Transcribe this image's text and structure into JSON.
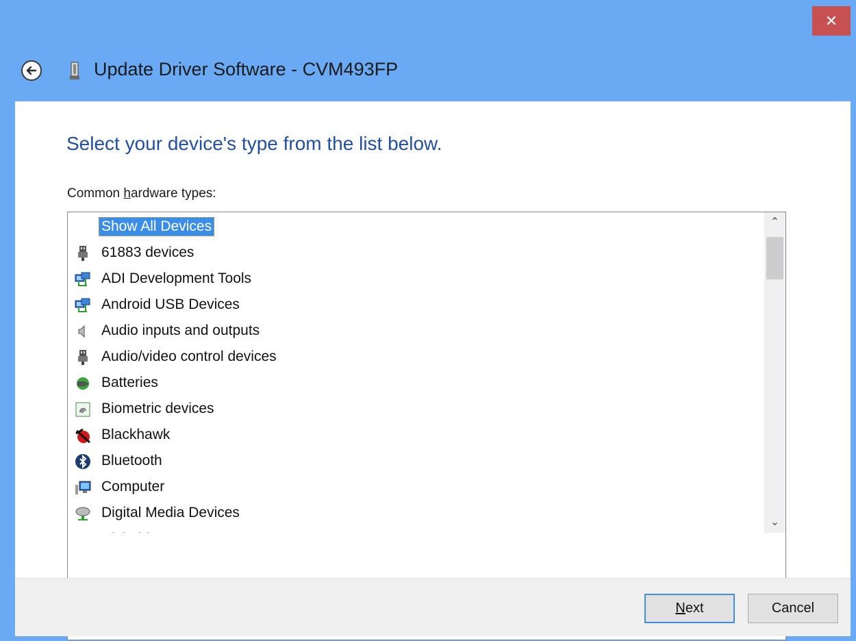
{
  "window": {
    "title": "Update Driver Software - CVM493FP",
    "close_glyph": "✕"
  },
  "main": {
    "heading": "Select your device's type from the list below.",
    "list_label_pre": "Common ",
    "list_label_u": "h",
    "list_label_post": "ardware types:"
  },
  "list": {
    "items": [
      {
        "label": "Show All Devices",
        "icon": "none",
        "selected": true
      },
      {
        "label": "61883 devices",
        "icon": "usb-plug-icon"
      },
      {
        "label": "ADI Development Tools",
        "icon": "network-computers-icon"
      },
      {
        "label": "Android USB Devices",
        "icon": "network-computers-icon"
      },
      {
        "label": "Audio inputs and outputs",
        "icon": "speaker-icon"
      },
      {
        "label": "Audio/video control devices",
        "icon": "usb-plug-icon"
      },
      {
        "label": "Batteries",
        "icon": "battery-plug-icon"
      },
      {
        "label": "Biometric devices",
        "icon": "fingerprint-icon"
      },
      {
        "label": "Blackhawk",
        "icon": "blackhawk-bug-icon"
      },
      {
        "label": "Bluetooth",
        "icon": "bluetooth-icon"
      },
      {
        "label": "Computer",
        "icon": "computer-icon"
      },
      {
        "label": "Digital Media Devices",
        "icon": "media-device-icon"
      },
      {
        "label": "Disk drives",
        "icon": "disk-drive-icon"
      }
    ]
  },
  "footer": {
    "next_u": "N",
    "next_rest": "ext",
    "cancel": "Cancel"
  },
  "colors": {
    "titlebar": "#6aaaf4",
    "close": "#c75050",
    "heading": "#1f4fa8",
    "selection": "#3b8ee8"
  }
}
